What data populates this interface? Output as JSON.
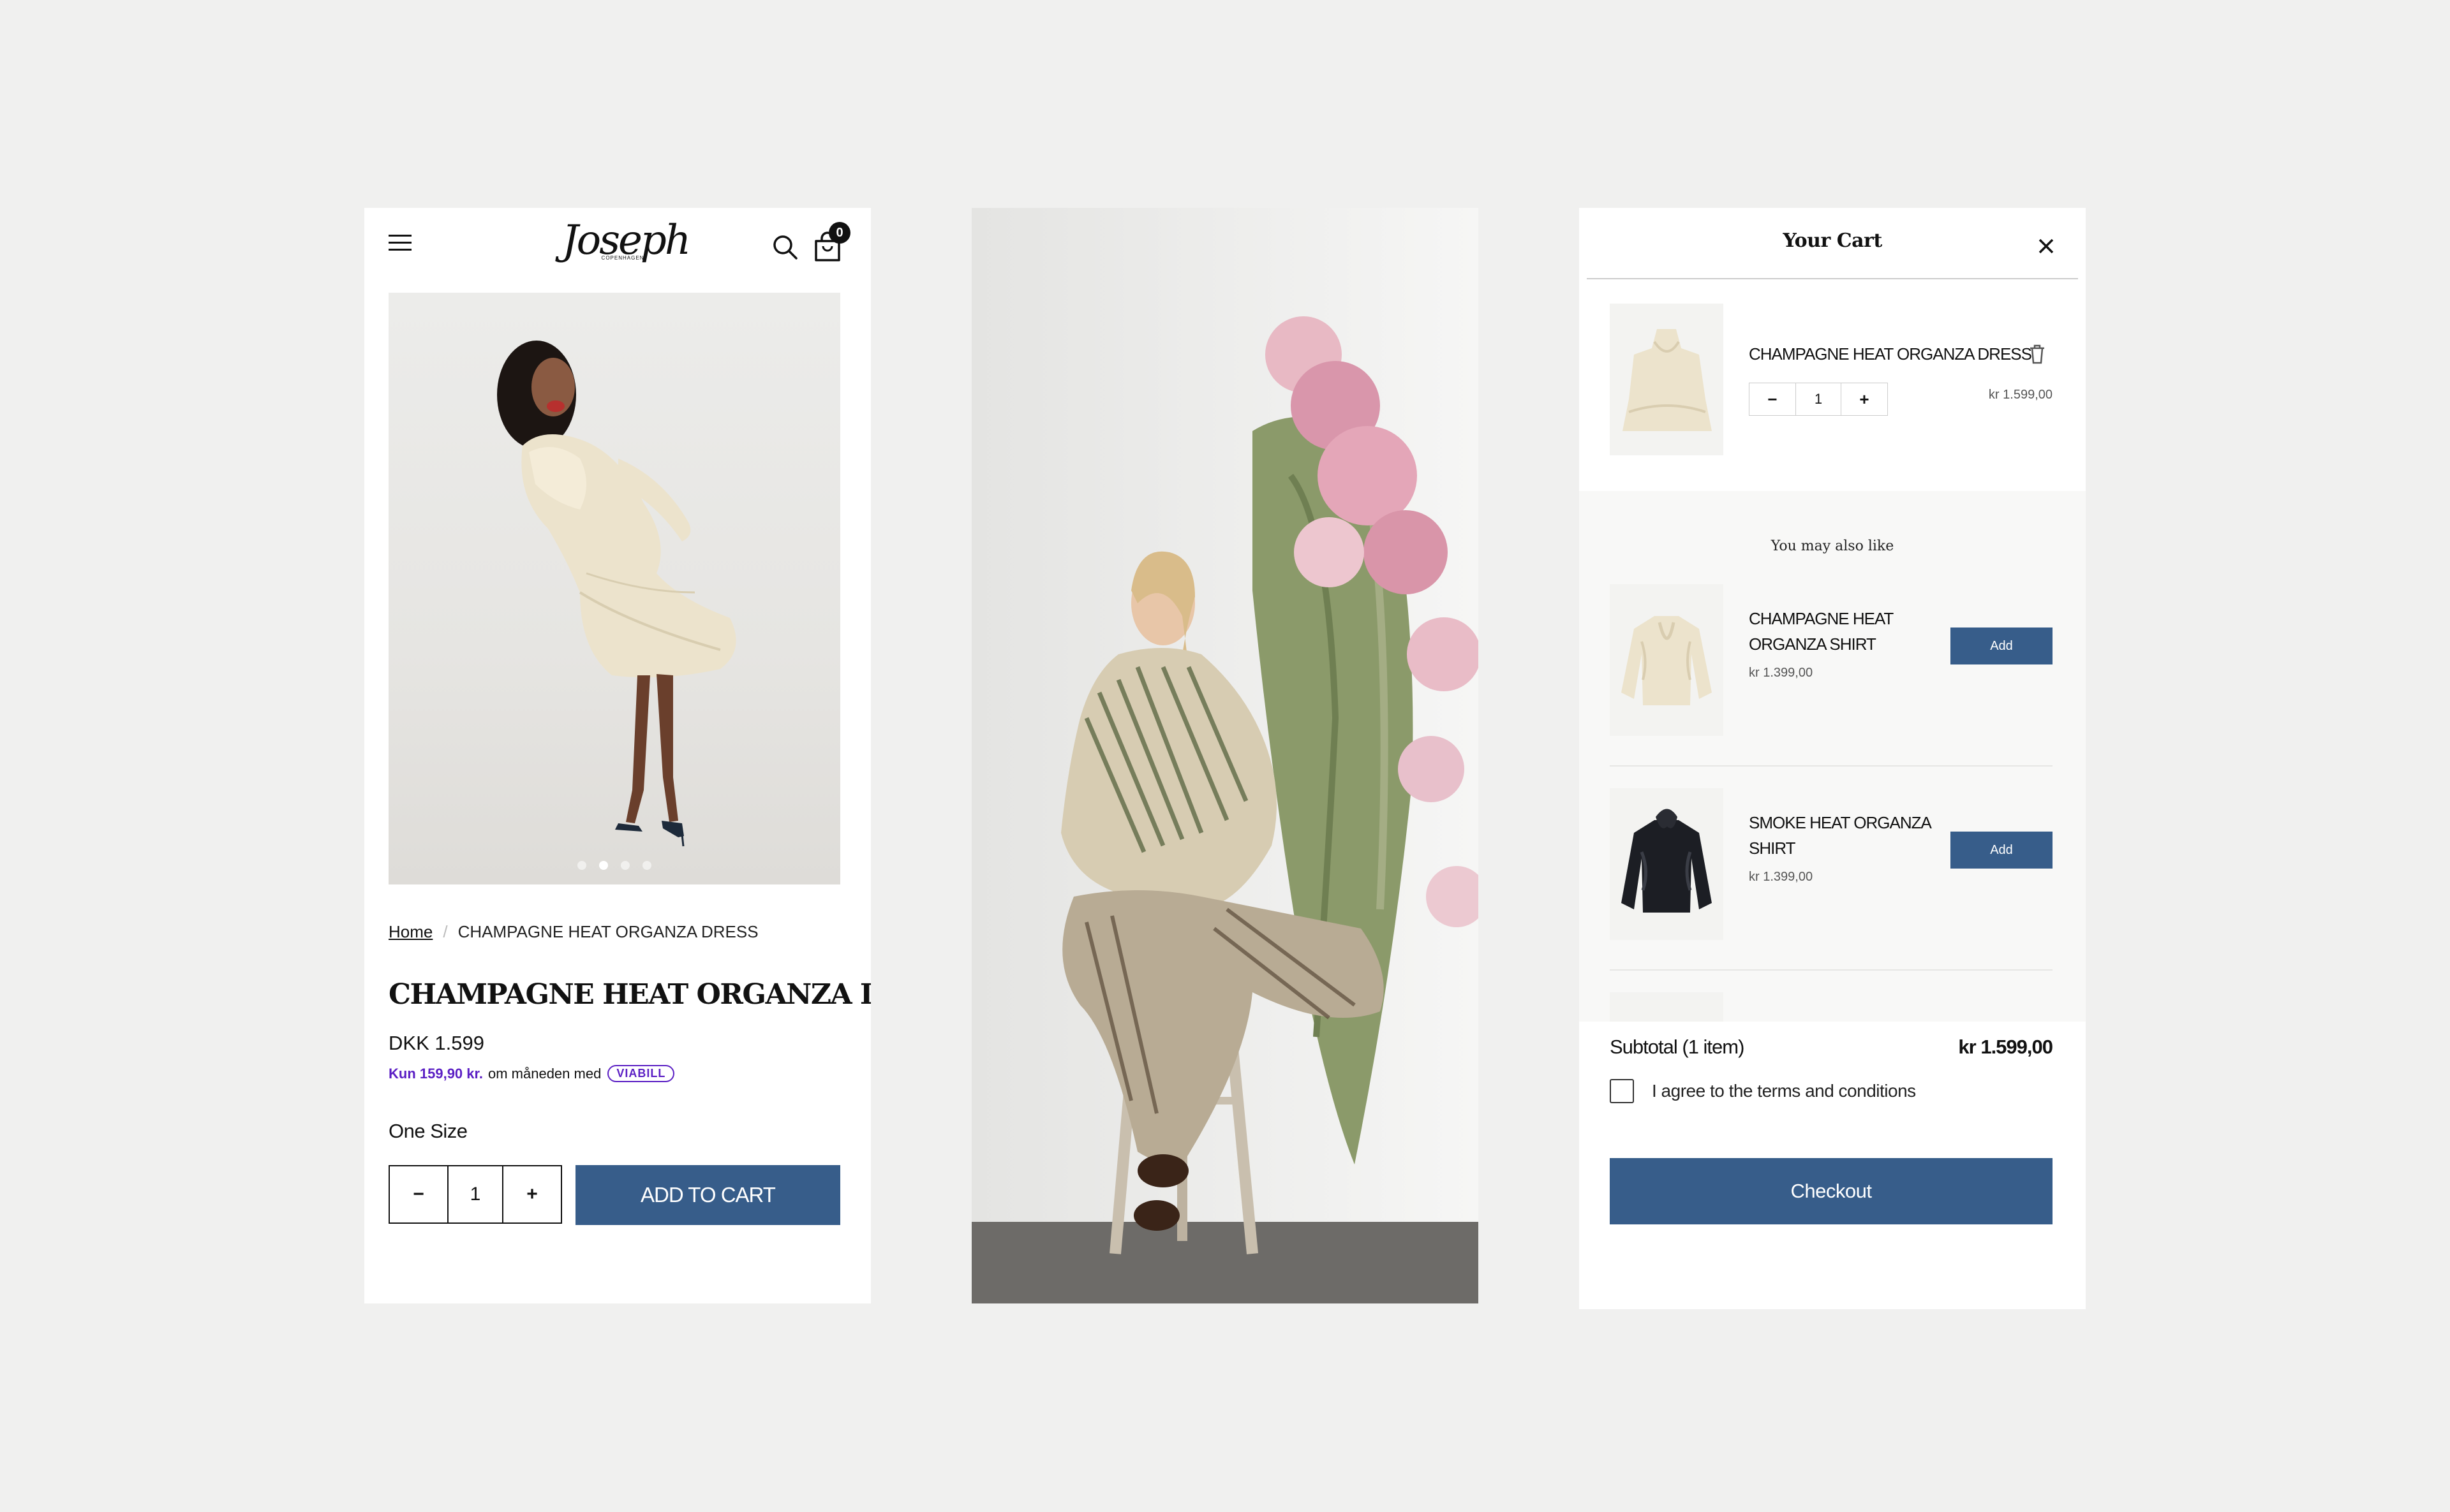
{
  "header": {
    "logo": "Joseph",
    "logo_sub": "COPENHAGEN",
    "cart_count": "0"
  },
  "gallery": {
    "slide_count": 4,
    "active_slide": 2
  },
  "breadcrumb": {
    "home": "Home",
    "current": "CHAMPAGNE HEAT ORGANZA DRESS"
  },
  "product": {
    "title": "CHAMPAGNE HEAT ORGANZA DRESS",
    "price": "DKK 1.599",
    "installment_highlight": "Kun 159,90 kr.",
    "installment_text": "om måneden med",
    "installment_brand": "VIABILL",
    "size": "One Size",
    "quantity": "1",
    "minus": "−",
    "plus": "+",
    "add_to_cart": "ADD TO CART"
  },
  "cart": {
    "title": "Your Cart",
    "line_item": {
      "name": "CHAMPAGNE HEAT ORGANZA DRESS",
      "quantity": "1",
      "minus": "−",
      "plus": "+",
      "price": "kr 1.599,00"
    },
    "recommendations_title": "You may also like",
    "recommendations": [
      {
        "name": "CHAMPAGNE HEAT ORGANZA SHIRT",
        "price": "kr 1.399,00",
        "button": "Add"
      },
      {
        "name": "SMOKE HEAT ORGANZA SHIRT",
        "price": "kr 1.399,00",
        "button": "Add"
      }
    ],
    "subtotal_label": "Subtotal (1 item)",
    "subtotal_value": "kr 1.599,00",
    "terms": "I agree to the terms and conditions",
    "checkout": "Checkout"
  },
  "colors": {
    "accent": "#375d8a",
    "viabill": "#5b1fc4",
    "background": "#f0f0ef"
  }
}
